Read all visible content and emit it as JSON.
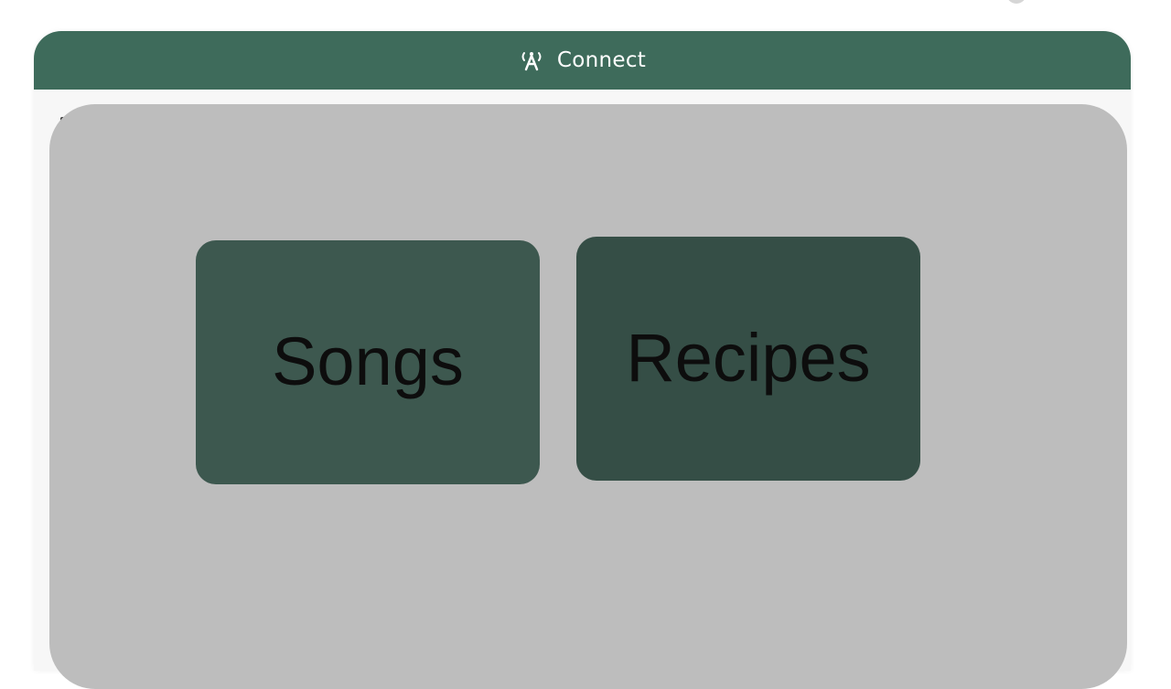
{
  "header": {
    "title": "Connect",
    "icon": "broadcast-tower-icon"
  },
  "chooser": {
    "options": [
      {
        "label": "Songs",
        "color": "#3d584f"
      },
      {
        "label": "Recipes",
        "color": "#354e46"
      }
    ]
  },
  "colors": {
    "header_bg": "#3e6b5b",
    "overlay_bg": "#bdbdbd",
    "panel_bg": "#f7f7f7"
  }
}
